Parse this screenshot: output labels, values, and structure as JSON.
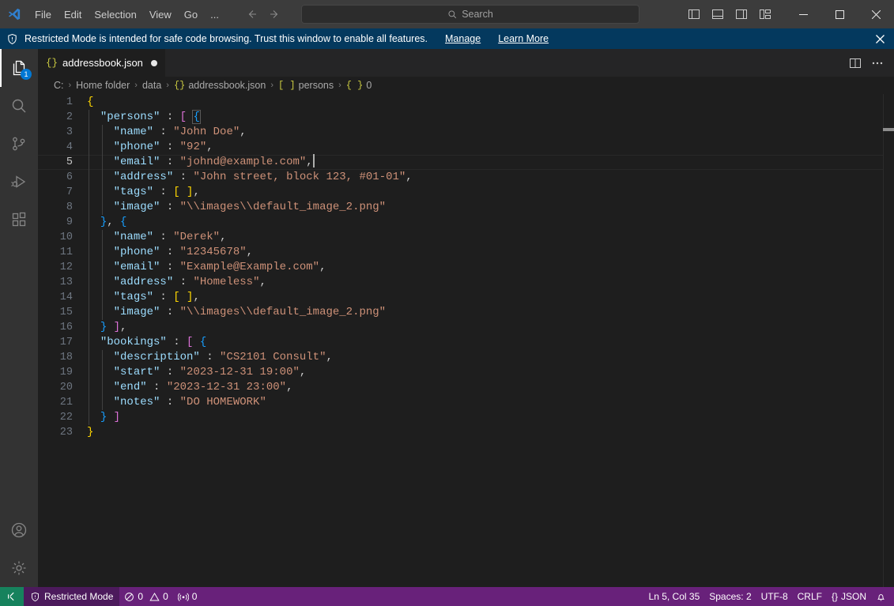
{
  "titlebar": {
    "logo_icon": "vscode-logo-icon",
    "menus": [
      "File",
      "Edit",
      "Selection",
      "View",
      "Go",
      "..."
    ],
    "nav_back_icon": "arrow-left-icon",
    "nav_forward_icon": "arrow-right-icon",
    "search_placeholder": "Search",
    "search_icon": "search-icon",
    "layout_icons": [
      "toggle-primary-sidebar-icon",
      "toggle-panel-icon",
      "toggle-secondary-sidebar-icon",
      "customize-layout-icon"
    ],
    "window_controls": {
      "minimize": "minimize-icon",
      "maximize": "maximize-icon",
      "close": "close-icon"
    }
  },
  "banner": {
    "icon": "shield-icon",
    "message": "Restricted Mode is intended for safe code browsing. Trust this window to enable all features.",
    "links": [
      "Manage",
      "Learn More"
    ],
    "close_icon": "close-icon",
    "background": "#04395e"
  },
  "activitybar": {
    "items": [
      {
        "name": "explorer",
        "icon": "files-icon",
        "badge": "1",
        "active": true
      },
      {
        "name": "search",
        "icon": "search-icon",
        "badge": "",
        "active": false
      },
      {
        "name": "source-control",
        "icon": "source-control-icon",
        "badge": "",
        "active": false
      },
      {
        "name": "run-debug",
        "icon": "run-and-debug-icon",
        "badge": "",
        "active": false
      },
      {
        "name": "extensions",
        "icon": "extensions-icon",
        "badge": "",
        "active": false
      }
    ],
    "bottom_items": [
      {
        "name": "accounts",
        "icon": "account-icon"
      },
      {
        "name": "settings",
        "icon": "gear-icon"
      }
    ]
  },
  "editor": {
    "tab": {
      "icon_label": "{}",
      "filename": "addressbook.json",
      "dirty": true
    },
    "tab_actions": [
      "split-editor-icon",
      "more-actions-icon"
    ],
    "breadcrumb": [
      {
        "label": "C:",
        "icon": ""
      },
      {
        "label": "Home folder",
        "icon": ""
      },
      {
        "label": "data",
        "icon": ""
      },
      {
        "label": "addressbook.json",
        "icon": "{}"
      },
      {
        "label": "persons",
        "icon": "[ ]"
      },
      {
        "label": "0",
        "icon": "{ }"
      }
    ],
    "current_line": 5,
    "lines": [
      {
        "n": 1,
        "tokens": [
          {
            "t": "{",
            "c": "brace"
          }
        ],
        "indent": 0
      },
      {
        "n": 2,
        "tokens": [
          {
            "t": "  ",
            "c": "punc"
          },
          {
            "t": "\"persons\"",
            "c": "key"
          },
          {
            "t": " : ",
            "c": "colon"
          },
          {
            "t": "[",
            "c": "brack"
          },
          {
            "t": " ",
            "c": "punc"
          },
          {
            "t": "{",
            "c": "brace2-hl"
          }
        ],
        "indent": 1
      },
      {
        "n": 3,
        "tokens": [
          {
            "t": "    ",
            "c": "punc"
          },
          {
            "t": "\"name\"",
            "c": "key"
          },
          {
            "t": " : ",
            "c": "colon"
          },
          {
            "t": "\"John Doe\"",
            "c": "str"
          },
          {
            "t": ",",
            "c": "punc"
          }
        ],
        "indent": 2
      },
      {
        "n": 4,
        "tokens": [
          {
            "t": "    ",
            "c": "punc"
          },
          {
            "t": "\"phone\"",
            "c": "key"
          },
          {
            "t": " : ",
            "c": "colon"
          },
          {
            "t": "\"92\"",
            "c": "str"
          },
          {
            "t": ",",
            "c": "punc"
          }
        ],
        "indent": 2
      },
      {
        "n": 5,
        "tokens": [
          {
            "t": "    ",
            "c": "punc"
          },
          {
            "t": "\"email\"",
            "c": "key"
          },
          {
            "t": " : ",
            "c": "colon"
          },
          {
            "t": "\"johnd@example.com\"",
            "c": "str"
          },
          {
            "t": ",",
            "c": "punc"
          },
          {
            "t": "",
            "c": "cursor"
          }
        ],
        "indent": 2
      },
      {
        "n": 6,
        "tokens": [
          {
            "t": "    ",
            "c": "punc"
          },
          {
            "t": "\"address\"",
            "c": "key"
          },
          {
            "t": " : ",
            "c": "colon"
          },
          {
            "t": "\"John street, block 123, #01-01\"",
            "c": "str"
          },
          {
            "t": ",",
            "c": "punc"
          }
        ],
        "indent": 2
      },
      {
        "n": 7,
        "tokens": [
          {
            "t": "    ",
            "c": "punc"
          },
          {
            "t": "\"tags\"",
            "c": "key"
          },
          {
            "t": " : ",
            "c": "colon"
          },
          {
            "t": "[ ]",
            "c": "brace"
          },
          {
            "t": ",",
            "c": "punc"
          }
        ],
        "indent": 2
      },
      {
        "n": 8,
        "tokens": [
          {
            "t": "    ",
            "c": "punc"
          },
          {
            "t": "\"image\"",
            "c": "key"
          },
          {
            "t": " : ",
            "c": "colon"
          },
          {
            "t": "\"\\\\images\\\\default_image_2.png\"",
            "c": "str"
          }
        ],
        "indent": 2
      },
      {
        "n": 9,
        "tokens": [
          {
            "t": "  ",
            "c": "punc"
          },
          {
            "t": "}",
            "c": "brace2"
          },
          {
            "t": ", ",
            "c": "punc"
          },
          {
            "t": "{",
            "c": "brace2"
          }
        ],
        "indent": 1
      },
      {
        "n": 10,
        "tokens": [
          {
            "t": "    ",
            "c": "punc"
          },
          {
            "t": "\"name\"",
            "c": "key"
          },
          {
            "t": " : ",
            "c": "colon"
          },
          {
            "t": "\"Derek\"",
            "c": "str"
          },
          {
            "t": ",",
            "c": "punc"
          }
        ],
        "indent": 2
      },
      {
        "n": 11,
        "tokens": [
          {
            "t": "    ",
            "c": "punc"
          },
          {
            "t": "\"phone\"",
            "c": "key"
          },
          {
            "t": " : ",
            "c": "colon"
          },
          {
            "t": "\"12345678\"",
            "c": "str"
          },
          {
            "t": ",",
            "c": "punc"
          }
        ],
        "indent": 2
      },
      {
        "n": 12,
        "tokens": [
          {
            "t": "    ",
            "c": "punc"
          },
          {
            "t": "\"email\"",
            "c": "key"
          },
          {
            "t": " : ",
            "c": "colon"
          },
          {
            "t": "\"Example@Example.com\"",
            "c": "str"
          },
          {
            "t": ",",
            "c": "punc"
          }
        ],
        "indent": 2
      },
      {
        "n": 13,
        "tokens": [
          {
            "t": "    ",
            "c": "punc"
          },
          {
            "t": "\"address\"",
            "c": "key"
          },
          {
            "t": " : ",
            "c": "colon"
          },
          {
            "t": "\"Homeless\"",
            "c": "str"
          },
          {
            "t": ",",
            "c": "punc"
          }
        ],
        "indent": 2
      },
      {
        "n": 14,
        "tokens": [
          {
            "t": "    ",
            "c": "punc"
          },
          {
            "t": "\"tags\"",
            "c": "key"
          },
          {
            "t": " : ",
            "c": "colon"
          },
          {
            "t": "[ ]",
            "c": "brace"
          },
          {
            "t": ",",
            "c": "punc"
          }
        ],
        "indent": 2
      },
      {
        "n": 15,
        "tokens": [
          {
            "t": "    ",
            "c": "punc"
          },
          {
            "t": "\"image\"",
            "c": "key"
          },
          {
            "t": " : ",
            "c": "colon"
          },
          {
            "t": "\"\\\\images\\\\default_image_2.png\"",
            "c": "str"
          }
        ],
        "indent": 2
      },
      {
        "n": 16,
        "tokens": [
          {
            "t": "  ",
            "c": "punc"
          },
          {
            "t": "}",
            "c": "brace2"
          },
          {
            "t": " ",
            "c": "punc"
          },
          {
            "t": "]",
            "c": "brack"
          },
          {
            "t": ",",
            "c": "punc"
          }
        ],
        "indent": 1
      },
      {
        "n": 17,
        "tokens": [
          {
            "t": "  ",
            "c": "punc"
          },
          {
            "t": "\"bookings\"",
            "c": "key"
          },
          {
            "t": " : ",
            "c": "colon"
          },
          {
            "t": "[",
            "c": "brack"
          },
          {
            "t": " ",
            "c": "punc"
          },
          {
            "t": "{",
            "c": "brace2"
          }
        ],
        "indent": 1
      },
      {
        "n": 18,
        "tokens": [
          {
            "t": "    ",
            "c": "punc"
          },
          {
            "t": "\"description\"",
            "c": "key"
          },
          {
            "t": " : ",
            "c": "colon"
          },
          {
            "t": "\"CS2101 Consult\"",
            "c": "str"
          },
          {
            "t": ",",
            "c": "punc"
          }
        ],
        "indent": 2
      },
      {
        "n": 19,
        "tokens": [
          {
            "t": "    ",
            "c": "punc"
          },
          {
            "t": "\"start\"",
            "c": "key"
          },
          {
            "t": " : ",
            "c": "colon"
          },
          {
            "t": "\"2023-12-31 19:00\"",
            "c": "str"
          },
          {
            "t": ",",
            "c": "punc"
          }
        ],
        "indent": 2
      },
      {
        "n": 20,
        "tokens": [
          {
            "t": "    ",
            "c": "punc"
          },
          {
            "t": "\"end\"",
            "c": "key"
          },
          {
            "t": " : ",
            "c": "colon"
          },
          {
            "t": "\"2023-12-31 23:00\"",
            "c": "str"
          },
          {
            "t": ",",
            "c": "punc"
          }
        ],
        "indent": 2
      },
      {
        "n": 21,
        "tokens": [
          {
            "t": "    ",
            "c": "punc"
          },
          {
            "t": "\"notes\"",
            "c": "key"
          },
          {
            "t": " : ",
            "c": "colon"
          },
          {
            "t": "\"DO HOMEWORK\"",
            "c": "str"
          }
        ],
        "indent": 2
      },
      {
        "n": 22,
        "tokens": [
          {
            "t": "  ",
            "c": "punc"
          },
          {
            "t": "}",
            "c": "brace2"
          },
          {
            "t": " ",
            "c": "punc"
          },
          {
            "t": "]",
            "c": "brack"
          }
        ],
        "indent": 1
      },
      {
        "n": 23,
        "tokens": [
          {
            "t": "}",
            "c": "brace"
          }
        ],
        "indent": 0
      }
    ]
  },
  "statusbar": {
    "remote_icon": "remote-window-icon",
    "restricted_icon": "shield-icon",
    "restricted_label": "Restricted Mode",
    "errors_icon": "error-icon",
    "errors_count": "0",
    "warnings_icon": "warning-icon",
    "warnings_count": "0",
    "ports_icon": "ports-icon",
    "ports_count": "0",
    "cursor_position": "Ln 5, Col 35",
    "indentation": "Spaces: 2",
    "encoding": "UTF-8",
    "eol": "CRLF",
    "language_icon": "{}",
    "language": "JSON",
    "bell_icon": "bell-icon",
    "background": "#68217a"
  }
}
